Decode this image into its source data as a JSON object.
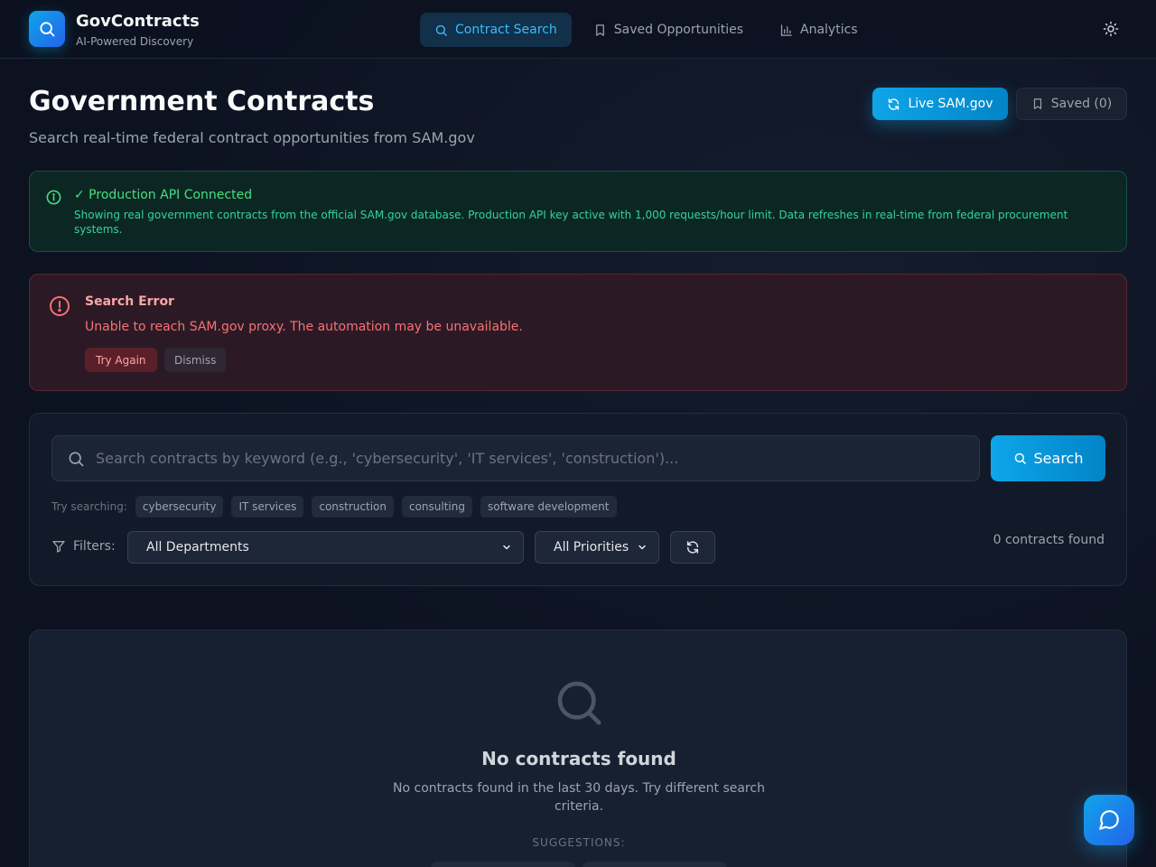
{
  "brand": {
    "title": "GovContracts",
    "subtitle": "AI-Powered Discovery"
  },
  "nav": {
    "items": [
      {
        "label": "Contract Search",
        "icon": "search-icon",
        "active": true
      },
      {
        "label": "Saved Opportunities",
        "icon": "bookmark-icon",
        "active": false
      },
      {
        "label": "Analytics",
        "icon": "bar-chart-icon",
        "active": false
      }
    ]
  },
  "page": {
    "title": "Government Contracts",
    "subtitle": "Search real-time federal contract opportunities from SAM.gov",
    "live_label": "Live SAM.gov",
    "saved_label": "Saved (0)"
  },
  "api_banner": {
    "title": "✓ Production API Connected",
    "text": "Showing real government contracts from the official SAM.gov database. Production API key active with 1,000 requests/hour limit. Data refreshes in real-time from federal procurement systems."
  },
  "error": {
    "title": "Search Error",
    "message": "Unable to reach SAM.gov proxy. The automation may be unavailable.",
    "retry_label": "Try Again",
    "dismiss_label": "Dismiss"
  },
  "search": {
    "placeholder": "Search contracts by keyword (e.g., 'cybersecurity', 'IT services', 'construction')...",
    "value": "",
    "button_label": "Search",
    "try_label": "Try searching:",
    "suggestions": [
      "cybersecurity",
      "IT services",
      "construction",
      "consulting",
      "software development"
    ],
    "filters_label": "Filters:",
    "department": "All Departments",
    "priority": "All Priorities",
    "count_text": "0 contracts found"
  },
  "empty": {
    "title": "No contracts found",
    "text": "No contracts found in the last 30 days. Try different search criteria.",
    "suggestions_label": "SUGGESTIONS:"
  },
  "colors": {
    "accent": "#0ea5e9",
    "success": "#4ade80",
    "error": "#f87171",
    "background": "#0c1220"
  }
}
